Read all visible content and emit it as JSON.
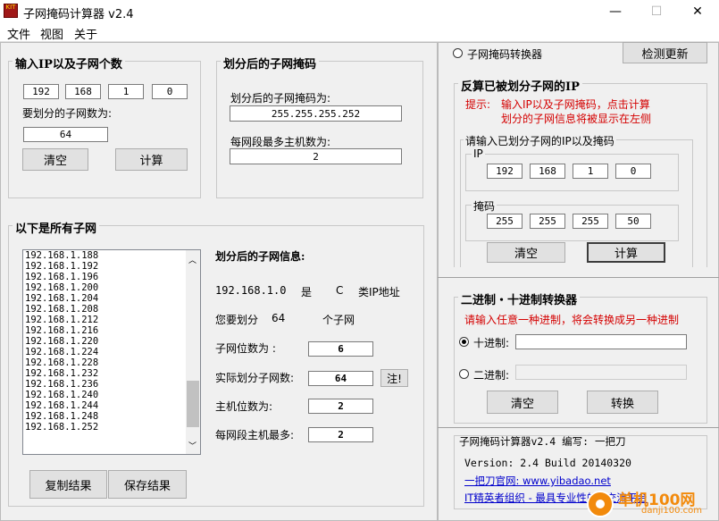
{
  "window": {
    "title": "子网掩码计算器 v2.4",
    "icon_text": "KIT",
    "minimize": "—",
    "maximize": "☐",
    "close": "✕"
  },
  "menu": [
    "文件",
    "视图",
    "关于"
  ],
  "input_group": {
    "title": "输入IP以及子网个数",
    "ip": [
      "192",
      "168",
      "1",
      "0"
    ],
    "count_label": "要划分的子网数为:",
    "count_value": "64",
    "clear_label": "清空",
    "calc_label": "计算"
  },
  "mask_group": {
    "title": "划分后的子网掩码",
    "mask_label": "划分后的子网掩码为:",
    "mask_value": "255.255.255.252",
    "hosts_label": "每网段最多主机数为:",
    "hosts_value": "2"
  },
  "subnets_group": {
    "title": "以下是所有子网",
    "list": [
      "192.168.1.188",
      "192.168.1.192",
      "192.168.1.196",
      "192.168.1.200",
      "192.168.1.204",
      "192.168.1.208",
      "192.168.1.212",
      "192.168.1.216",
      "192.168.1.220",
      "192.168.1.224",
      "192.168.1.228",
      "192.168.1.232",
      "192.168.1.236",
      "192.168.1.240",
      "192.168.1.244",
      "192.168.1.248",
      "192.168.1.252"
    ],
    "list_scroll_fraction": 0.9,
    "info_title": "划分后的子网信息:",
    "class_ip": "192.168.1.0",
    "class_is": "是",
    "class_letter": "C",
    "class_suffix": "类IP地址",
    "divide_prefix": "您要划分",
    "divide_count": "64",
    "divide_suffix": "个子网",
    "subnet_bits_label": "子网位数为 :",
    "subnet_bits_value": "6",
    "actual_label": "实际划分子网数:",
    "actual_value": "64",
    "note_label": "注!",
    "host_bits_label": "主机位数为:",
    "host_bits_value": "2",
    "max_hosts_label": "每网段主机最多:",
    "max_hosts_value": "2",
    "copy_label": "复制结果",
    "save_label": "保存结果"
  },
  "converter": {
    "radio_label": "子网掩码转换器",
    "check_update_label": "检测更新",
    "reverse_title": "反算已被划分子网的IP",
    "hint_prefix": "提示:",
    "hint_line1": "输入IP以及子网掩码，点击计算",
    "hint_line2": "划分的子网信息将被显示在左侧",
    "inner_title": "请输入已划分子网的IP以及掩码",
    "ip_title": "IP",
    "ip": [
      "192",
      "168",
      "1",
      "0"
    ],
    "mask_title": "掩码",
    "mask": [
      "255",
      "255",
      "255",
      "50"
    ],
    "clear_label": "清空",
    "calc_label": "计算"
  },
  "base_converter": {
    "title": "二进制・十进制转换器",
    "hint": "请输入任意一种进制，将会转换成另一种进制",
    "decimal_label": "十进制:",
    "decimal_value": "",
    "binary_label": "二进制:",
    "binary_value": "",
    "clear_label": "清空",
    "convert_label": "转换"
  },
  "about": {
    "title_line": "子网掩码计算器v2.4   编写: 一把刀",
    "version_line": "Version: 2.4   Build 20140320",
    "site_line": "一把刀官网: www.yibadao.net",
    "org_line": "IT精英者组织 - 最具专业性的IT交流平台"
  },
  "watermark": {
    "text1": "单机100网",
    "text2": "danji100.com"
  },
  "colors": {
    "accent_red": "#d40000",
    "link_blue": "#0000cc"
  }
}
